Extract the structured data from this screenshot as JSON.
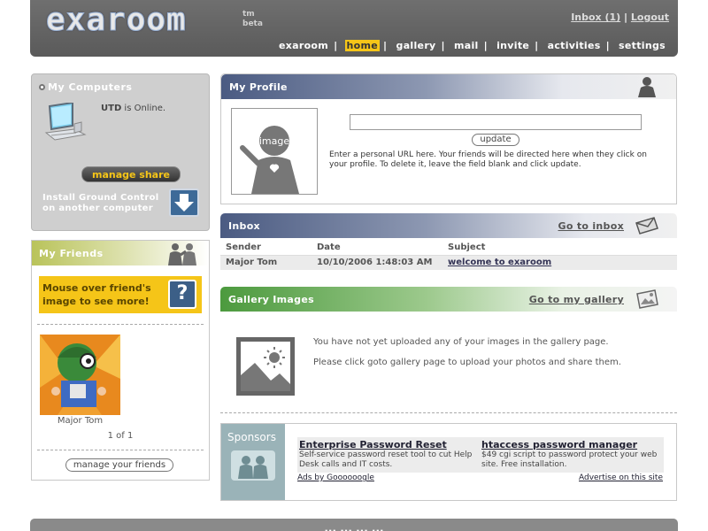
{
  "header": {
    "logo": "exaroom",
    "logo_tm": "tm",
    "logo_beta": "beta",
    "inbox_link": "Inbox (1)",
    "separator": "|",
    "logout_link": "Logout",
    "nav": [
      "exaroom",
      "home",
      "gallery",
      "mail",
      "invite",
      "activities",
      "settings"
    ],
    "nav_active": "home"
  },
  "computers": {
    "title": "My Computers",
    "computer_name": "UTD",
    "status_text": " is Online.",
    "manage_share": "manage share",
    "install_text": "Install Ground Control on another computer"
  },
  "friends": {
    "title": "My Friends",
    "mouse_over_text": "Mouse over friend's image to see more!",
    "question_mark": "?",
    "friend_name": "Major Tom",
    "pager": "1   of   1",
    "manage_button": "manage your friends"
  },
  "profile": {
    "title": "My Profile",
    "photo_label": "image",
    "url_value": "",
    "update_button": "update",
    "help_text": "Enter a personal URL here. Your friends will be directed here when they click on your profile. To delete it, leave the field blank and click update."
  },
  "inbox": {
    "title": "Inbox",
    "link": "Go to inbox",
    "columns": [
      "Sender",
      "Date",
      "Subject"
    ],
    "rows": [
      {
        "sender": "Major Tom",
        "date": "10/10/2006 1:48:03 AM",
        "subject": "welcome to exaroom"
      }
    ]
  },
  "gallery": {
    "title": "Gallery Images",
    "link": "Go to my gallery",
    "message1": "You have not yet uploaded any of your images in the gallery page.",
    "message2": "Please click goto gallery page to upload your photos and share them."
  },
  "sponsors": {
    "title": "Sponsors",
    "ads": [
      {
        "title": "Enterprise Password Reset",
        "text": "Self-service password reset tool to cut Help Desk calls and IT costs."
      },
      {
        "title": "htaccess password manager",
        "text": "$49 cgi script to password protect your web site. Free installation."
      }
    ],
    "ads_by": "Ads by Goooooogle",
    "advertise": "Advertise on this site"
  },
  "footer": {
    "text": "... ... ... ..."
  },
  "colors": {
    "accent_yellow": "#f5c518",
    "profile_blue": "#4b5b82",
    "gallery_green": "#4c9a3e",
    "friends_olive": "#b9c35a",
    "sponsor_teal": "#9ab3b8"
  }
}
